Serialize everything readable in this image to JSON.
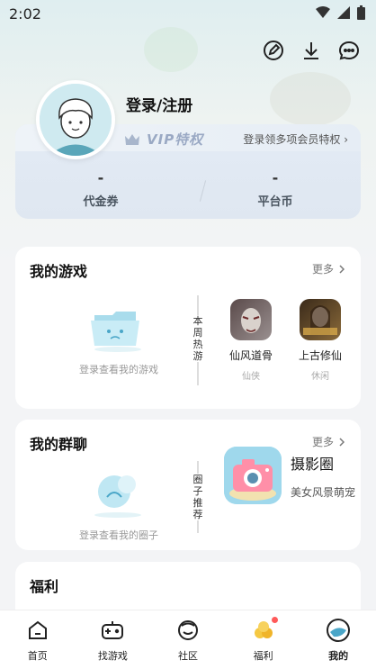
{
  "status": {
    "time": "2:02"
  },
  "icons": {
    "edit": "edit-icon",
    "download": "download-icon",
    "message": "message-icon"
  },
  "user": {
    "login_label": "登录/注册"
  },
  "vip": {
    "badge": "VIP特权",
    "link": "登录领多项会员特权 ›",
    "coupon_value": "-",
    "coupon_label": "代金券",
    "coin_value": "-",
    "coin_label": "平台币"
  },
  "my_games": {
    "title": "我的游戏",
    "more": "更多",
    "empty_text": "登录查看我的游戏",
    "side_label": "本周热游",
    "games": [
      {
        "name": "仙风道骨",
        "tag": "仙侠"
      },
      {
        "name": "上古修仙",
        "tag": "休闲"
      }
    ]
  },
  "my_groups": {
    "title": "我的群聊",
    "more": "更多",
    "empty_text": "登录查看我的圈子",
    "side_label": "圈子推荐",
    "recommend": {
      "name": "摄影圈",
      "desc": "美女风景萌宠"
    }
  },
  "welfare": {
    "title": "福利"
  },
  "tabs": [
    {
      "label": "首页"
    },
    {
      "label": "找游戏"
    },
    {
      "label": "社区"
    },
    {
      "label": "福利"
    },
    {
      "label": "我的"
    }
  ],
  "colors": {
    "accent": "#4aa6c8",
    "dot": "#ff5a5a"
  }
}
